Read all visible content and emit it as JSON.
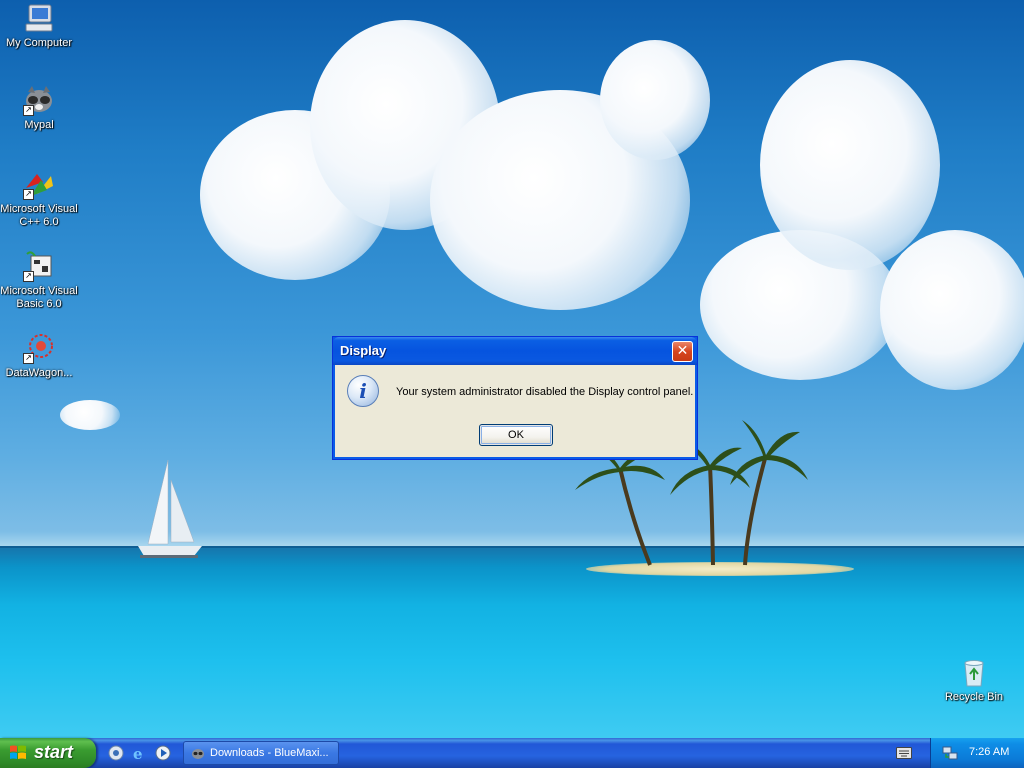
{
  "desktop": {
    "icons": [
      {
        "label": "My Computer",
        "icon": "my-computer-icon"
      },
      {
        "label": "Mypal",
        "icon": "mypal-icon"
      },
      {
        "label": "Microsoft Visual C++ 6.0",
        "icon": "visual-cpp-icon"
      },
      {
        "label": "Microsoft Visual Basic 6.0",
        "icon": "visual-basic-icon"
      },
      {
        "label": "DataWagon...",
        "icon": "datawagon-icon"
      },
      {
        "label": "Recycle Bin",
        "icon": "recycle-bin-icon"
      }
    ]
  },
  "dialog": {
    "title": "Display",
    "close_label": "✕",
    "message": "Your system administrator disabled the Display control panel.",
    "ok_label": "OK"
  },
  "taskbar": {
    "start_label": "start",
    "window_button": "Downloads - BlueMaxi...",
    "clock": "7:26 AM"
  },
  "colors": {
    "dialog_bg": "#ece9d8",
    "titlebar": "#0654df",
    "taskbar": "#2663e0",
    "start": "#3a9c30",
    "tray": "#0b7bd8"
  }
}
